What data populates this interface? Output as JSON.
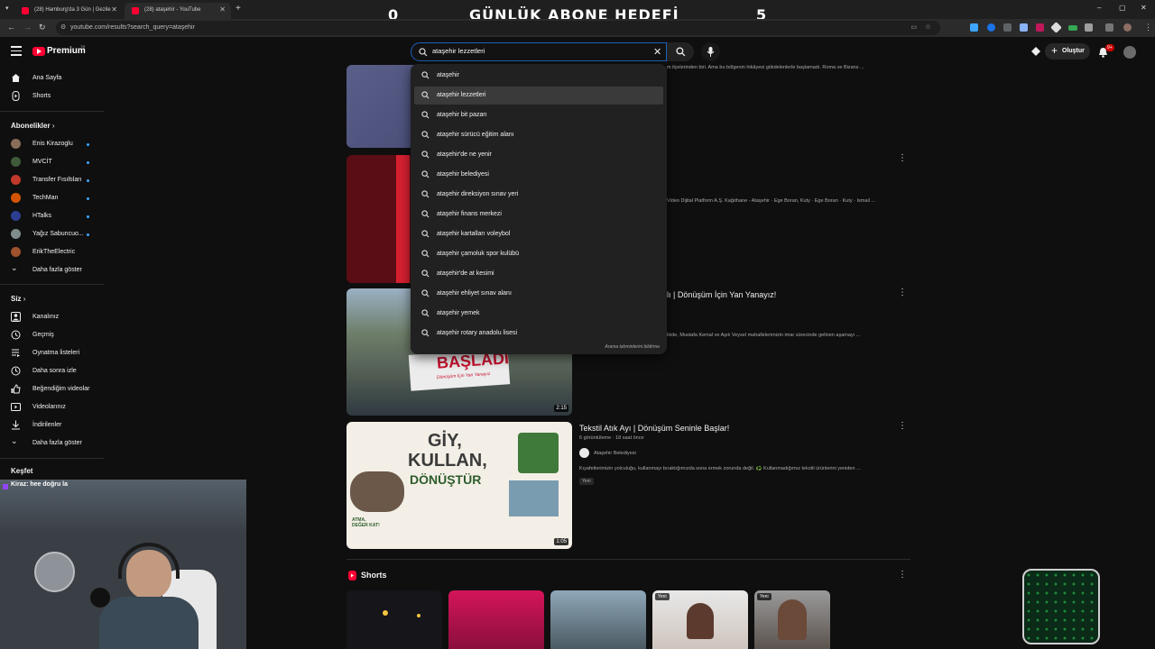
{
  "browser": {
    "tabs": [
      {
        "label": "(28) Hamburg'da 3 Gün | Gezile"
      },
      {
        "label": "(28) ataşehir - YouTube"
      }
    ],
    "new_tab": "+",
    "url": "youtube.com/results?search_query=ataşehir",
    "window_controls": {
      "minimize": "–",
      "maximize": "▢",
      "close": "✕"
    }
  },
  "overlay": {
    "title": "GÜNLÜK ABONE HEDEFİ",
    "left_count": "0",
    "right_count": "5"
  },
  "header": {
    "logo_text": "Premium",
    "logo_region": "TR",
    "search_value": "ataşehir lezzetleri",
    "create_label": "Oluştur",
    "notification_count": "9+"
  },
  "sidebar": {
    "main": [
      {
        "label": "Ana Sayfa",
        "icon": "home-icon"
      },
      {
        "label": "Shorts",
        "icon": "shorts-icon"
      }
    ],
    "subscriptions_header": "Abonelikler",
    "subscriptions": [
      {
        "label": "Enis Kirazoglu",
        "color": "#8a6e5a"
      },
      {
        "label": "MVCİT",
        "color": "#3f5a3a"
      },
      {
        "label": "Transfer Fısıltıları",
        "color": "#c0392b"
      },
      {
        "label": "TechMan",
        "color": "#d35400"
      },
      {
        "label": "HTalks",
        "color": "#2c3e90"
      },
      {
        "label": "Yağız Sabuncuo...",
        "color": "#7f8c8d"
      },
      {
        "label": "ErikTheElectric",
        "color": "#a0522d"
      }
    ],
    "subs_more": "Daha fazla göster",
    "you_header": "Siz",
    "you_items": [
      {
        "label": "Kanalınız",
        "icon": "channel-icon"
      },
      {
        "label": "Geçmiş",
        "icon": "history-icon"
      },
      {
        "label": "Oynatma listeleri",
        "icon": "playlist-icon"
      },
      {
        "label": "Daha sonra izle",
        "icon": "clock-icon"
      },
      {
        "label": "Beğendiğim videolar",
        "icon": "like-icon"
      },
      {
        "label": "Videolarınız",
        "icon": "video-icon"
      },
      {
        "label": "İndirilenler",
        "icon": "download-icon"
      },
      {
        "label": "Daha fazla göster",
        "icon": "chevron-down-icon"
      }
    ],
    "explore_header": "Keşfet"
  },
  "search_suggestions": [
    "ataşehir",
    "ataşehir lezzetleri",
    "ataşehir bit pazarı",
    "ataşehir sürücü eğitim alanı",
    "ataşehir'de ne yenir",
    "ataşehir belediyesi",
    "ataşehir direksiyon sınav yeri",
    "ataşehir finans merkezi",
    "ataşehir kartalları voleybol",
    "ataşehir çamoluk spor kulübü",
    "ataşehir'de at kesimi",
    "ataşehir ehliyet sınav alanı",
    "ataşehir yemek",
    "ataşehir rotary anadolu lisesi"
  ],
  "report_label": "Arama tahminlerini bildirme",
  "results": {
    "r1_desc": "m ilçelerinden biri. Ama bu bölgenin hikâyesi gökdelenlerle başlamadı. Roma ve Bizans ...",
    "r2_desc": "Video Dijital Platform A.Ş. Kağıthane - Ataşehir · Ege Boran, Kuty · Ege Boran · Kuty · İsmail ...",
    "r3_title": "lı | Dönüşüm İçin Yan Yanayız!",
    "r3_desc": "likde, Mustafa Kemal ve Aşık Veysel mahallelerimizin imar sürecinde gelinen aşamayı ...",
    "r3_duration": "2:15",
    "r3_thumb_text": "BAŞLADI",
    "r3_thumb_sub": "Dönüşüm İçin Yan Yanayız",
    "r4_title": "Tekstil Atık Ayı | Dönüşüm Seninle Başlar!",
    "r4_meta": "6 görüntüleme · 18 saat önce",
    "r4_channel": "Ataşehir Belediyesi",
    "r4_desc": "Kıyafetlerimizin yolculuğu, kullanmayı bıraktığımızda sona ermek zorunda değil. ♻️ Kullanmadığımız tekstil ürünlerini yeniden ...",
    "r4_badge": "Yeni",
    "r4_duration": "1:05",
    "r4_thumb_lines": [
      "GİY,",
      "KULLAN,",
      "DÖNÜŞTÜR"
    ],
    "r4_thumb_stamp": "ATMA, DEĞER KAT!"
  },
  "shorts": {
    "header": "Shorts",
    "badges": [
      "Yeni",
      "Yeni"
    ]
  },
  "chat": {
    "text": "Kiraz: hee doğru la"
  }
}
